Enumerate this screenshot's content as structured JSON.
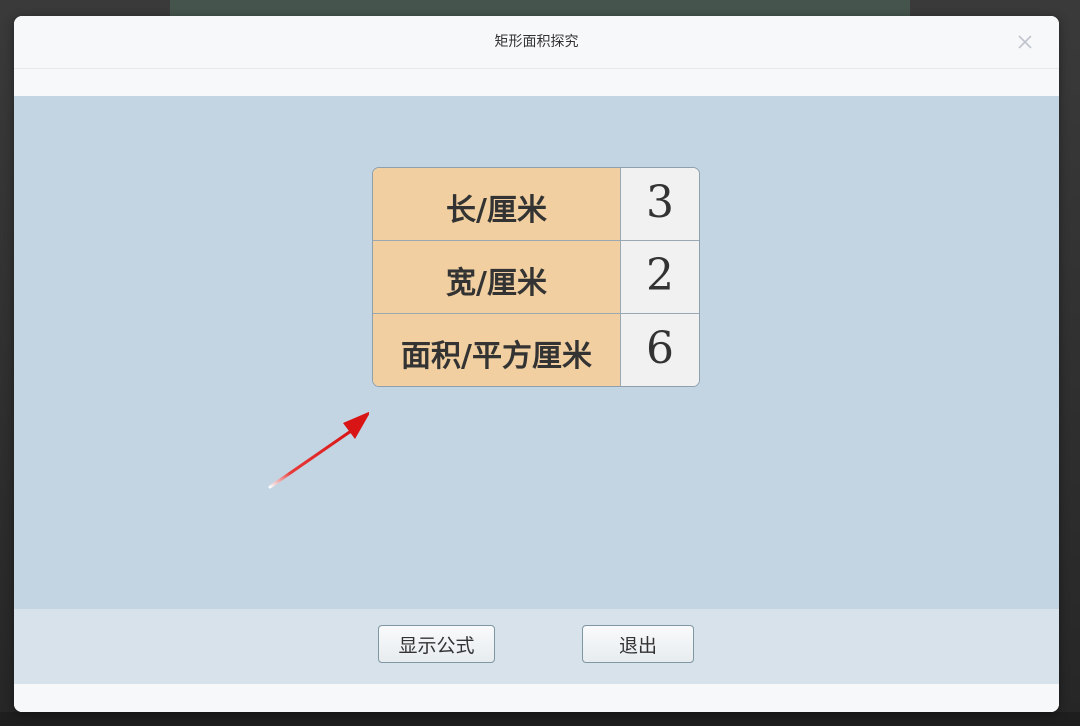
{
  "dialog": {
    "title": "矩形面积探究",
    "close_icon": "close-icon"
  },
  "table": {
    "rows": [
      {
        "label": "长/厘米",
        "value": "3"
      },
      {
        "label": "宽/厘米",
        "value": "2"
      },
      {
        "label": "面积/平方厘米",
        "value": "6"
      }
    ]
  },
  "footer": {
    "show_formula_label": "显示公式",
    "exit_label": "退出"
  },
  "colors": {
    "canvas_bg": "#c3d5e2",
    "label_cell_bg": "#f1cfa0",
    "value_cell_bg": "#f1f1f1",
    "arrow": "#e02020"
  }
}
